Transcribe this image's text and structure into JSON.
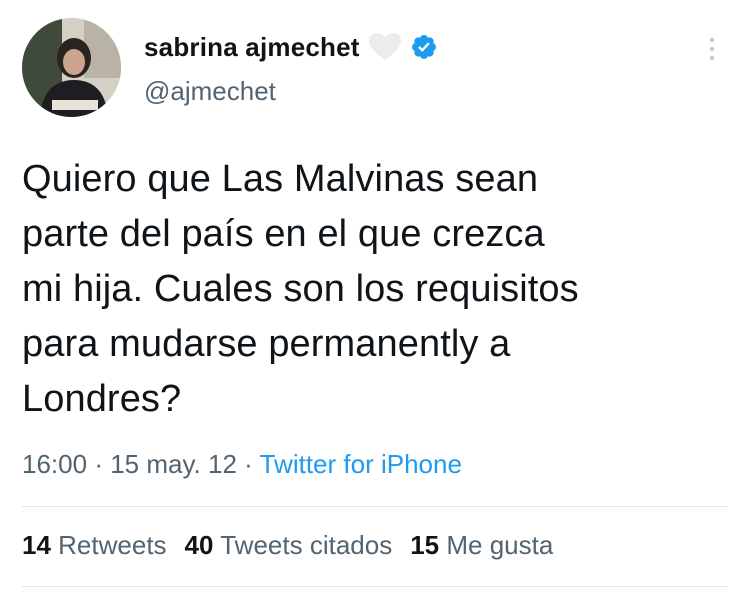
{
  "author": {
    "display_name": "sabrina ajmechet",
    "handle": "@ajmechet",
    "avatar_icon": "profile-photo"
  },
  "tweet": {
    "text": "Quiero que Las Malvinas sean\nparte del país en el que crezca\nmi hija. Cuales son los requisitos\npara mudarse permanently a\nLondres?",
    "time": "16:00",
    "separator": "·",
    "date": "15 may. 12",
    "source": "Twitter for iPhone"
  },
  "stats": {
    "retweets_count": "14",
    "retweets_label": "Retweets",
    "quotes_count": "40",
    "quotes_label": "Tweets citados",
    "likes_count": "15",
    "likes_label": "Me gusta"
  },
  "colors": {
    "text": "#0f1419",
    "secondary": "#536471",
    "accent": "#1d9bf0",
    "verified": "#1d9bf0"
  },
  "icons": {
    "heart": "heart-icon",
    "verified": "verified-badge-icon",
    "more": "more-vertical-icon"
  }
}
